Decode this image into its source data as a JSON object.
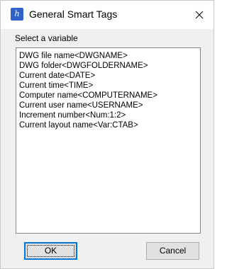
{
  "window": {
    "title": "General Smart Tags",
    "icon": "app-logo-icon",
    "icon_glyph": "h"
  },
  "main": {
    "prompt_label": "Select a variable",
    "variables": [
      "DWG file name<DWGNAME>",
      "DWG folder<DWGFOLDERNAME>",
      "Current date<DATE>",
      "Current time<TIME>",
      "Computer name<COMPUTERNAME>",
      "Current user name<USERNAME>",
      "Increment number<Num:1:2>",
      "Current layout name<Var:CTAB>"
    ]
  },
  "buttons": {
    "ok_label": "OK",
    "cancel_label": "Cancel"
  },
  "colors": {
    "accent": "#0078d7",
    "app_icon": "#2f63c9"
  }
}
